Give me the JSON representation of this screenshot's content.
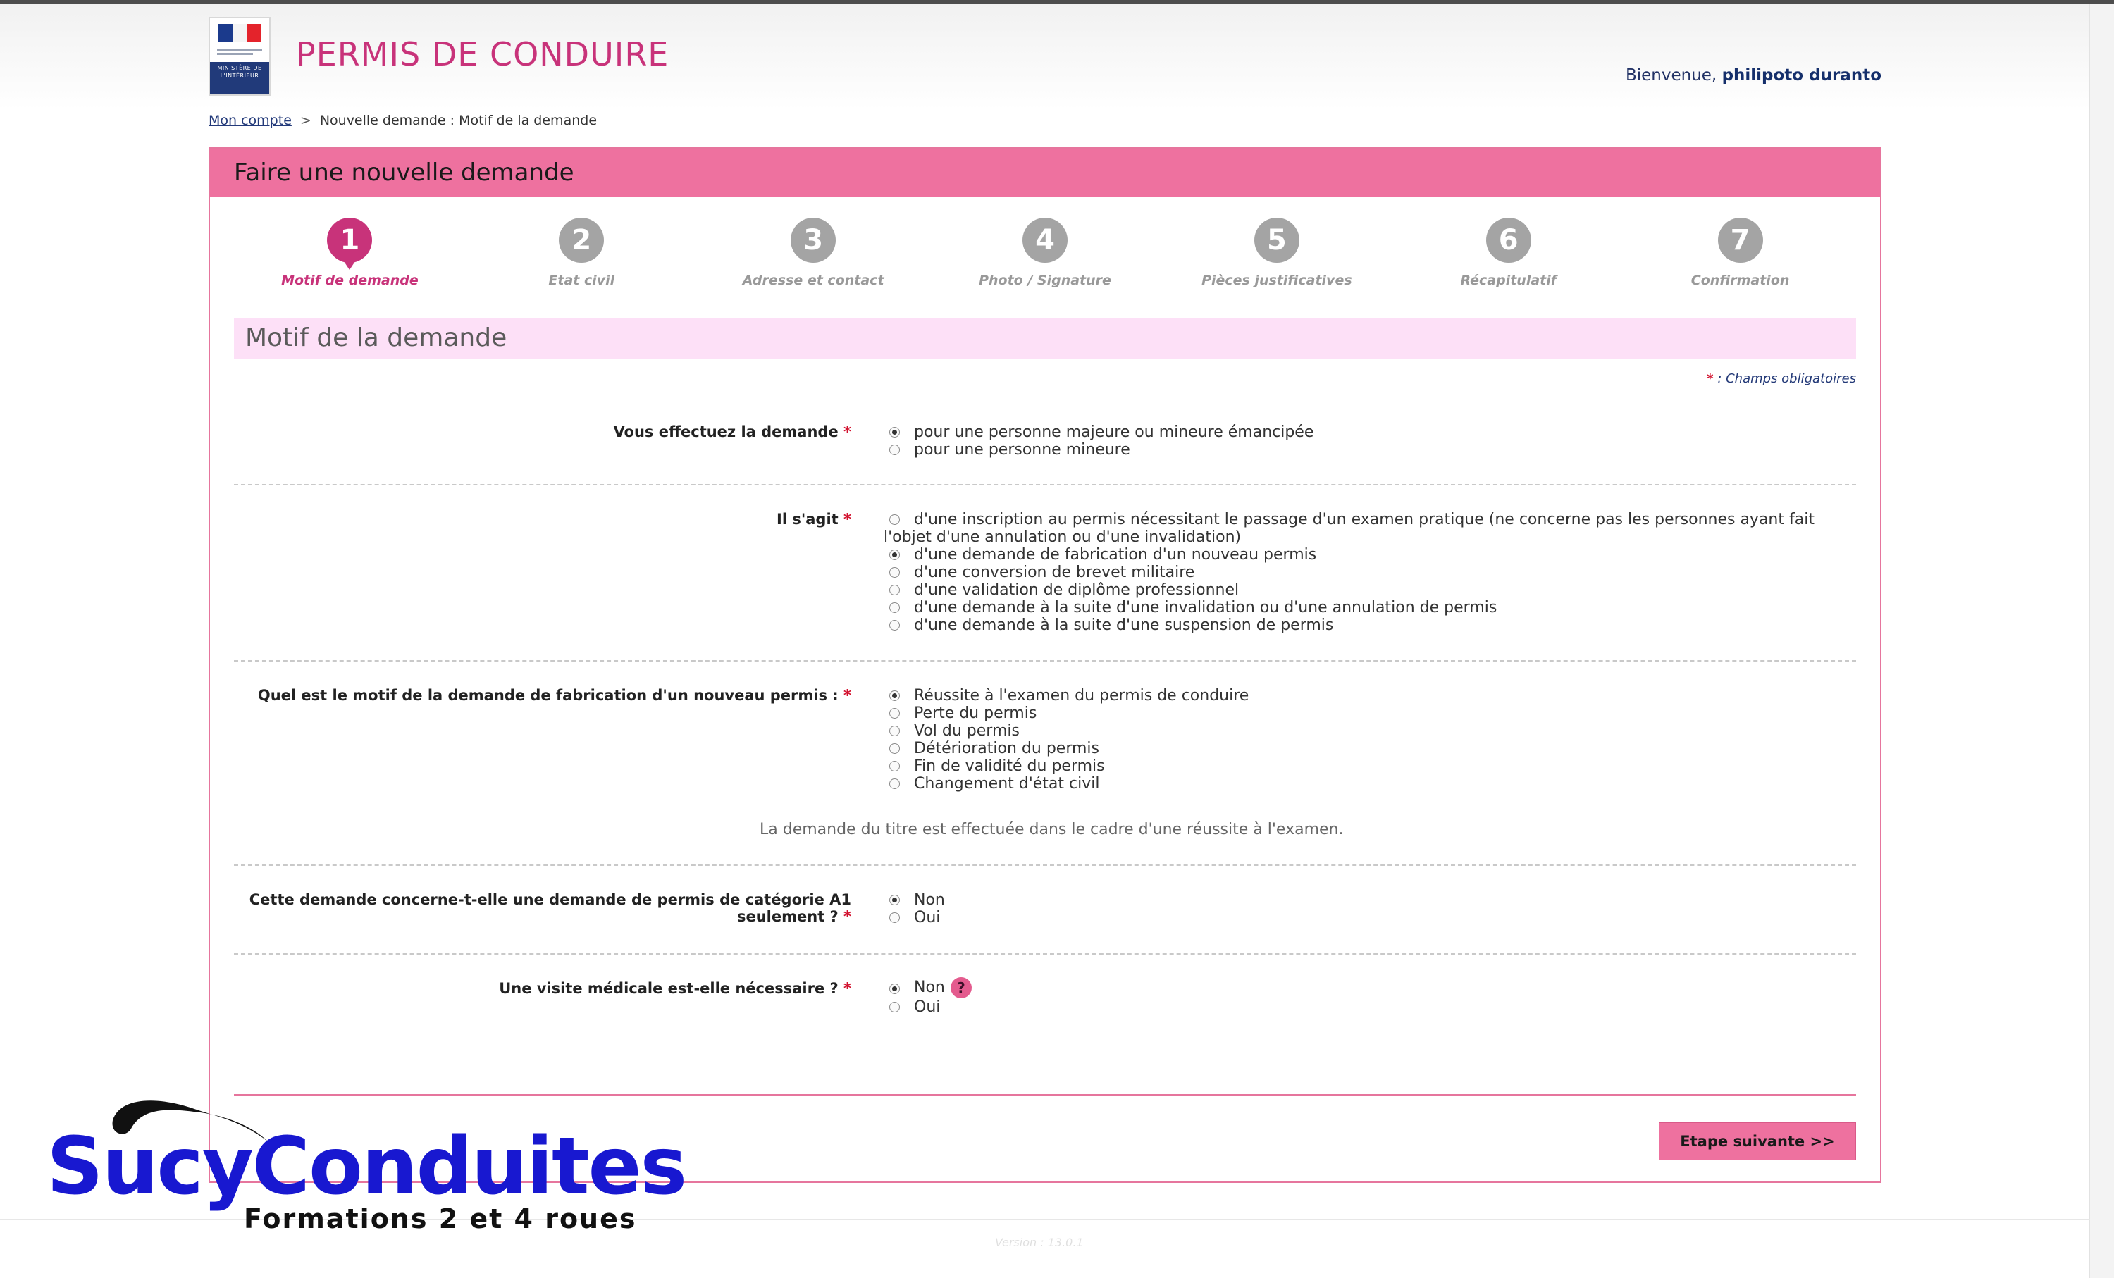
{
  "header": {
    "app_title": "PERMIS DE CONDUIRE",
    "logo": {
      "ministry_text": "MINISTÈRE DE L'INTÉRIEUR"
    },
    "welcome_prefix": "Bienvenue,",
    "user_name": "philipoto duranto"
  },
  "breadcrumb": {
    "home_link": "Mon compte",
    "separator": ">",
    "current": "Nouvelle demande : Motif de la demande"
  },
  "panel": {
    "title": "Faire une nouvelle demande",
    "steps": [
      {
        "number": "1",
        "label": "Motif de demande",
        "active": true
      },
      {
        "number": "2",
        "label": "Etat civil",
        "active": false
      },
      {
        "number": "3",
        "label": "Adresse et contact",
        "active": false
      },
      {
        "number": "4",
        "label": "Photo / Signature",
        "active": false
      },
      {
        "number": "5",
        "label": "Pièces justificatives",
        "active": false
      },
      {
        "number": "6",
        "label": "Récapitulatif",
        "active": false
      },
      {
        "number": "7",
        "label": "Confirmation",
        "active": false
      }
    ],
    "section_title": "Motif de la demande",
    "required_star": "*",
    "required_note": ": Champs obligatoires"
  },
  "form": {
    "q1": {
      "label": "Vous effectuez la demande",
      "options": [
        {
          "label": "pour une personne majeure ou mineure émancipée",
          "checked": true
        },
        {
          "label": "pour une personne mineure",
          "checked": false
        }
      ]
    },
    "q2": {
      "label": "Il s'agit",
      "options": [
        {
          "label": "d'une inscription au permis nécessitant le passage d'un examen pratique (ne concerne pas les personnes ayant fait",
          "label_cont": "l'objet d'une annulation ou d'une invalidation)",
          "checked": false
        },
        {
          "label": "d'une demande de fabrication d'un nouveau permis",
          "checked": true
        },
        {
          "label": "d'une conversion de brevet militaire",
          "checked": false
        },
        {
          "label": "d'une validation de diplôme professionnel",
          "checked": false
        },
        {
          "label": "d'une demande à la suite d'une invalidation ou d'une annulation de permis",
          "checked": false
        },
        {
          "label": "d'une demande à la suite d'une suspension de permis",
          "checked": false
        }
      ]
    },
    "q3": {
      "label": "Quel est le motif de la demande de fabrication d'un nouveau permis :",
      "options": [
        {
          "label": "Réussite à l'examen du permis de conduire",
          "checked": true
        },
        {
          "label": "Perte du permis",
          "checked": false
        },
        {
          "label": "Vol du permis",
          "checked": false
        },
        {
          "label": "Détérioration du permis",
          "checked": false
        },
        {
          "label": "Fin de validité du permis",
          "checked": false
        },
        {
          "label": "Changement d'état civil",
          "checked": false
        }
      ],
      "info": "La demande du titre est effectuée dans le cadre d'une réussite à l'examen."
    },
    "q4": {
      "label_line1": "Cette demande concerne-t-elle une demande de permis de catégorie A1",
      "label_line2": "seulement ?",
      "options": [
        {
          "label": "Non",
          "checked": true
        },
        {
          "label": "Oui",
          "checked": false
        }
      ]
    },
    "q5": {
      "label": "Une visite médicale est-elle nécessaire ?",
      "help": "?",
      "options": [
        {
          "label": "Non",
          "checked": true
        },
        {
          "label": "Oui",
          "checked": false
        }
      ]
    },
    "next_button": "Etape suivante  >>"
  },
  "footer": {
    "version": "Version : 13.0.1"
  },
  "watermark": {
    "brand": "SucyConduites",
    "tagline": "Formations 2 et 4 roues"
  },
  "colors": {
    "pink": "#ee719f",
    "magenta": "#c8337a",
    "section_bg": "#fde0f7",
    "step_inactive": "#a4a4a4",
    "required": "#d2112e",
    "watermark_blue": "#1818d0"
  }
}
